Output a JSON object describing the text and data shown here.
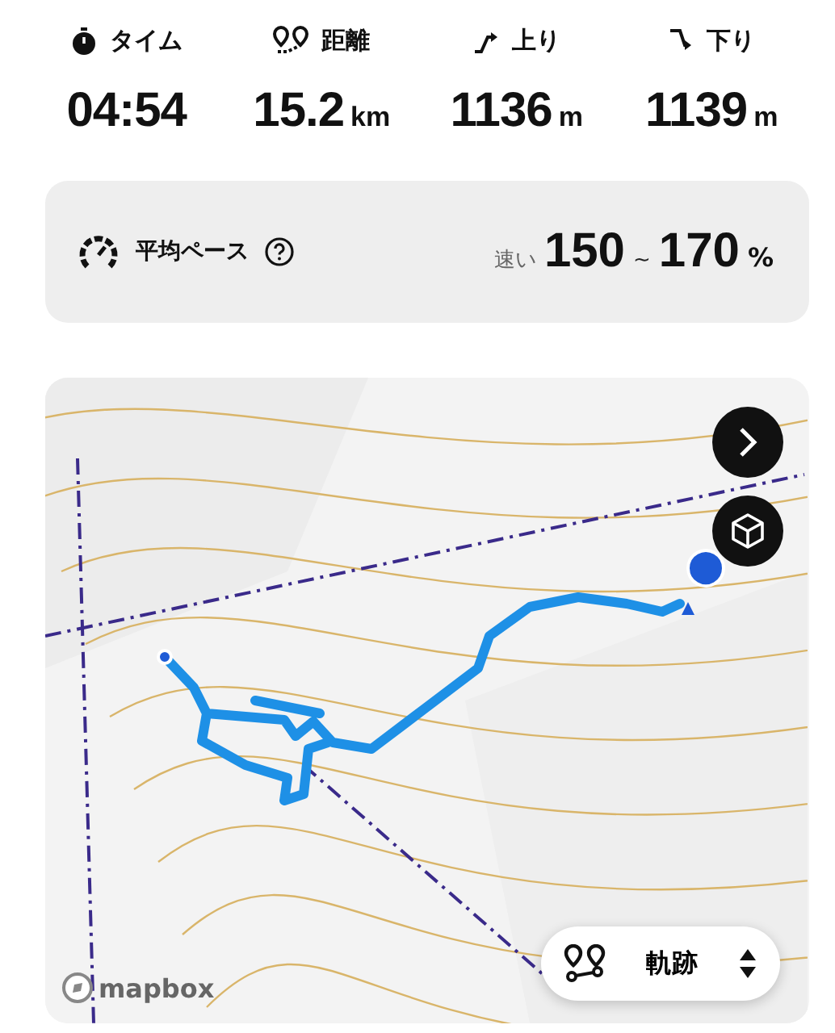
{
  "stats": [
    {
      "kind": "time",
      "label": "タイム",
      "value": "04:54"
    },
    {
      "kind": "distance",
      "label": "距離",
      "value": "15.2",
      "unit": "km"
    },
    {
      "kind": "ascent",
      "label": "上り",
      "value": "1136",
      "unit": "m"
    },
    {
      "kind": "descent",
      "label": "下り",
      "value": "1139",
      "unit": "m"
    }
  ],
  "pace": {
    "label": "平均ペース",
    "speed": "速い",
    "low": "150",
    "separator": "~",
    "high": "170",
    "unit": "%"
  },
  "map": {
    "attribution": "mapbox",
    "track_selector": {
      "label": "軌跡"
    }
  }
}
